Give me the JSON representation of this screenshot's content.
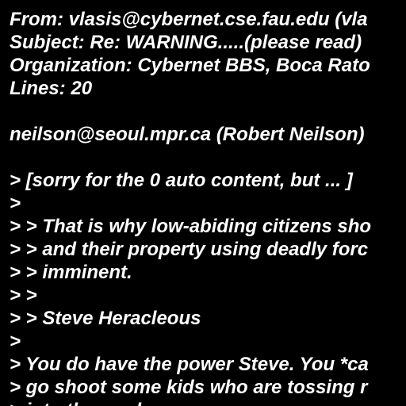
{
  "background_color": "#000000",
  "text_color": "#ffffff",
  "lines": [
    "From: vlasis@cybernet.cse.fau.edu (vla",
    "Subject: Re: WARNING.....(please read)",
    "Organization: Cybernet BBS, Boca Rato",
    "Lines: 20",
    "",
    "neilson@seoul.mpr.ca (Robert Neilson)",
    "",
    "> [sorry for the 0 auto content, but ... ]",
    ">",
    "> > That is why low-abiding citizens sho",
    "> > and their property using deadly forc",
    "> > imminent.",
    "> >",
    "> > Steve Heracleous",
    ">",
    "> You do have the power Steve. You *ca",
    "> go shoot some kids who are tossing r",
    "> into the road ..."
  ]
}
